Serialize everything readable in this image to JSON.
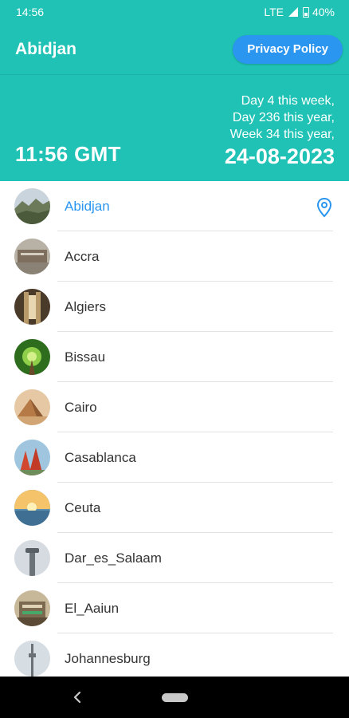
{
  "status_bar": {
    "time": "14:56",
    "network": "LTE",
    "battery": "40%"
  },
  "app_bar": {
    "title": "Abidjan",
    "privacy_label": "Privacy Policy"
  },
  "info": {
    "time_gmt": "11:56 GMT",
    "day_of_week": "Day 4 this week,",
    "day_of_year": "Day 236 this year,",
    "week_of_year": "Week 34 this year,",
    "date": "24-08-2023"
  },
  "cities": [
    {
      "name": "Abidjan",
      "selected": true,
      "thumb": "landscape-thumbnail"
    },
    {
      "name": "Accra",
      "selected": false,
      "thumb": "building-thumbnail"
    },
    {
      "name": "Algiers",
      "selected": false,
      "thumb": "interior-thumbnail"
    },
    {
      "name": "Bissau",
      "selected": false,
      "thumb": "forest-thumbnail"
    },
    {
      "name": "Cairo",
      "selected": false,
      "thumb": "pyramid-thumbnail"
    },
    {
      "name": "Casablanca",
      "selected": false,
      "thumb": "red-building-thumbnail"
    },
    {
      "name": "Ceuta",
      "selected": false,
      "thumb": "sunset-thumbnail"
    },
    {
      "name": "Dar_es_Salaam",
      "selected": false,
      "thumb": "tower-thumbnail"
    },
    {
      "name": "El_Aaiun",
      "selected": false,
      "thumb": "palace-thumbnail"
    },
    {
      "name": "Johannesburg",
      "selected": false,
      "thumb": "tv-tower-thumbnail"
    }
  ],
  "colors": {
    "accent": "#1fc2b4",
    "button": "#2b96ef",
    "selected_text": "#2b96ef"
  }
}
